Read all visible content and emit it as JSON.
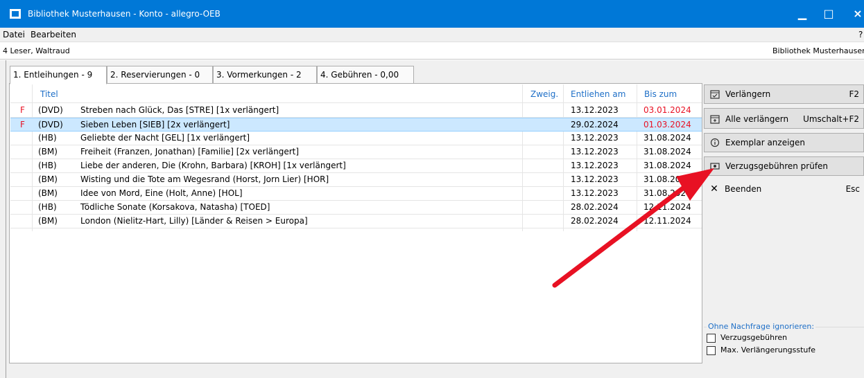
{
  "window": {
    "title": "Bibliothek Musterhausen - Konto - allegro-OEB",
    "min_glyph": "▁",
    "max_glyph": "□",
    "close_glyph": "×"
  },
  "menu": [
    "Datei",
    "Bearbeiten"
  ],
  "menu_help": "?",
  "info": {
    "reader": "4 Leser, Waltraud",
    "library": "Bibliothek Musterhausen"
  },
  "tabs": [
    {
      "label": "1. Entleihungen - 9"
    },
    {
      "label": "2. Reservierungen - 0"
    },
    {
      "label": "3. Vormerkungen - 2"
    },
    {
      "label": "4. Gebühren - 0,00"
    }
  ],
  "table": {
    "headers": {
      "title": "Titel",
      "branch": "Zweig.",
      "loaned": "Entliehen am",
      "due": "Bis zum"
    },
    "rows": [
      {
        "flag": "F",
        "type": "(DVD)",
        "title": "Streben nach Glück, Das   [STRE]  [1x verlängert]",
        "loaned": "13.12.2023",
        "due": "03.01.2024",
        "overdue": true
      },
      {
        "flag": "F",
        "type": "(DVD)",
        "title": "Sieben Leben   [SIEB]  [2x verlängert]",
        "loaned": "29.02.2024",
        "due": "01.03.2024",
        "overdue": true
      },
      {
        "flag": "",
        "type": "(HB)",
        "title": "Geliebte der Nacht   [GEL]  [1x verlängert]",
        "loaned": "13.12.2023",
        "due": "31.08.2024",
        "overdue": false
      },
      {
        "flag": "",
        "type": "(BM)",
        "title": "Freiheit (Franzen, Jonathan)   [Familie]  [2x verlängert]",
        "loaned": "13.12.2023",
        "due": "31.08.2024",
        "overdue": false
      },
      {
        "flag": "",
        "type": "(HB)",
        "title": "Liebe der anderen, Die (Krohn, Barbara)   [KROH]  [1x verlängert]",
        "loaned": "13.12.2023",
        "due": "31.08.2024",
        "overdue": false
      },
      {
        "flag": "",
        "type": "(BM)",
        "title": "Wisting und die Tote am Wegesrand (Horst, Jorn Lier)   [HOR]",
        "loaned": "13.12.2023",
        "due": "31.08.2024",
        "overdue": false
      },
      {
        "flag": "",
        "type": "(BM)",
        "title": "Idee von Mord, Eine (Holt, Anne)   [HOL]",
        "loaned": "13.12.2023",
        "due": "31.08.2024",
        "overdue": false
      },
      {
        "flag": "",
        "type": "(HB)",
        "title": "Tödliche Sonate (Korsakova, Natasha)   [TOED]",
        "loaned": "28.02.2024",
        "due": "12.11.2024",
        "overdue": false
      },
      {
        "flag": "",
        "type": "(BM)",
        "title": "London (Nielitz-Hart, Lilly)   [Länder & Reisen > Europa]",
        "loaned": "28.02.2024",
        "due": "12.11.2024",
        "overdue": false
      }
    ]
  },
  "buttons": {
    "renew": {
      "label": "Verlängern",
      "key": "F2",
      "icon": "calendar-check-icon"
    },
    "renew_all": {
      "label": "Alle verlängern",
      "key": "Umschalt+F2",
      "icon": "calendar-plus-icon"
    },
    "show_item": {
      "label": "Exemplar anzeigen",
      "icon": "info-icon"
    },
    "check_fees": {
      "label": "Verzugsgebühren prüfen",
      "icon": "money-icon"
    },
    "quit": {
      "label": "Beenden",
      "key": "Esc",
      "icon": "close-icon"
    }
  },
  "ignore_group": {
    "title": "Ohne Nachfrage ignorieren:",
    "options": [
      "Verzugsgebühren",
      "Max. Verlängerungsstufe"
    ]
  },
  "colors": {
    "accent": "#0078d7",
    "overdue": "#e81123",
    "selection": "#cce8ff",
    "arrow": "#e81123"
  }
}
